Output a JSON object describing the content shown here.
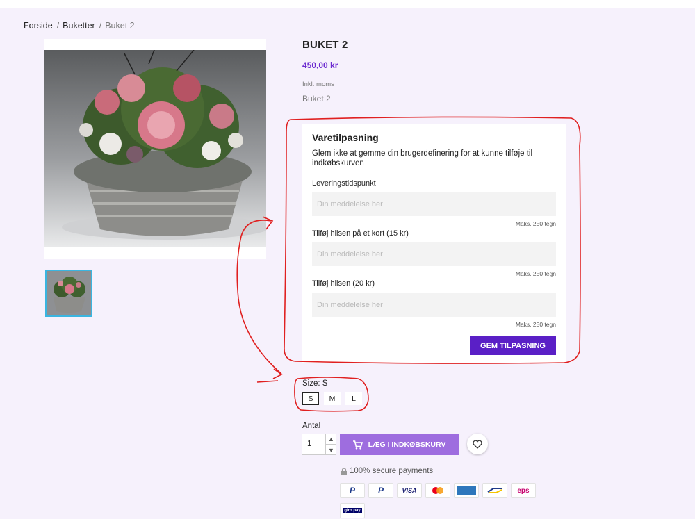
{
  "breadcrumb": [
    {
      "label": "Forside"
    },
    {
      "label": "Buketter"
    },
    {
      "label": "Buket 2"
    }
  ],
  "breadcrumb_sep": "/",
  "product": {
    "title": "BUKET 2",
    "price": "450,00 kr",
    "tax_label": "Inkl. moms",
    "short_description": "Buket 2"
  },
  "customization": {
    "heading": "Varetilpasning",
    "note": "Glem ikke at gemme din brugerdefinering for at kunne tilføje til indkøbskurven",
    "fields": [
      {
        "label": "Leveringstidspunkt",
        "placeholder": "Din meddelelse her",
        "max": "Maks. 250 tegn"
      },
      {
        "label": "Tilføj hilsen på et kort (15 kr)",
        "placeholder": "Din meddelelse her",
        "max": "Maks. 250 tegn"
      },
      {
        "label": "Tilføj hilsen (20 kr)",
        "placeholder": "Din meddelelse her",
        "max": "Maks. 250 tegn"
      }
    ],
    "save_label": "GEM TILPASNING"
  },
  "size": {
    "label": "Size: S",
    "options": [
      "S",
      "M",
      "L"
    ],
    "selected": "S"
  },
  "quantity": {
    "label": "Antal",
    "value": "1"
  },
  "add_to_cart_label": "LÆG I INDKØBSKURV",
  "secure_payments": "100% secure payments",
  "payment_icons": [
    "paypal-icon",
    "paypal-icon",
    "visa-icon",
    "mastercard-icon",
    "amex-icon",
    "bancontact-icon",
    "eps-icon",
    "giropay-icon"
  ],
  "payment_labels": {
    "visa": "VISA",
    "eps": "eps",
    "giropay": "giro pay"
  },
  "colors": {
    "accent": "#5a1fc6",
    "price": "#6c2bd0",
    "add_to_cart": "#9e6ddf",
    "annotation": "#e02020"
  }
}
